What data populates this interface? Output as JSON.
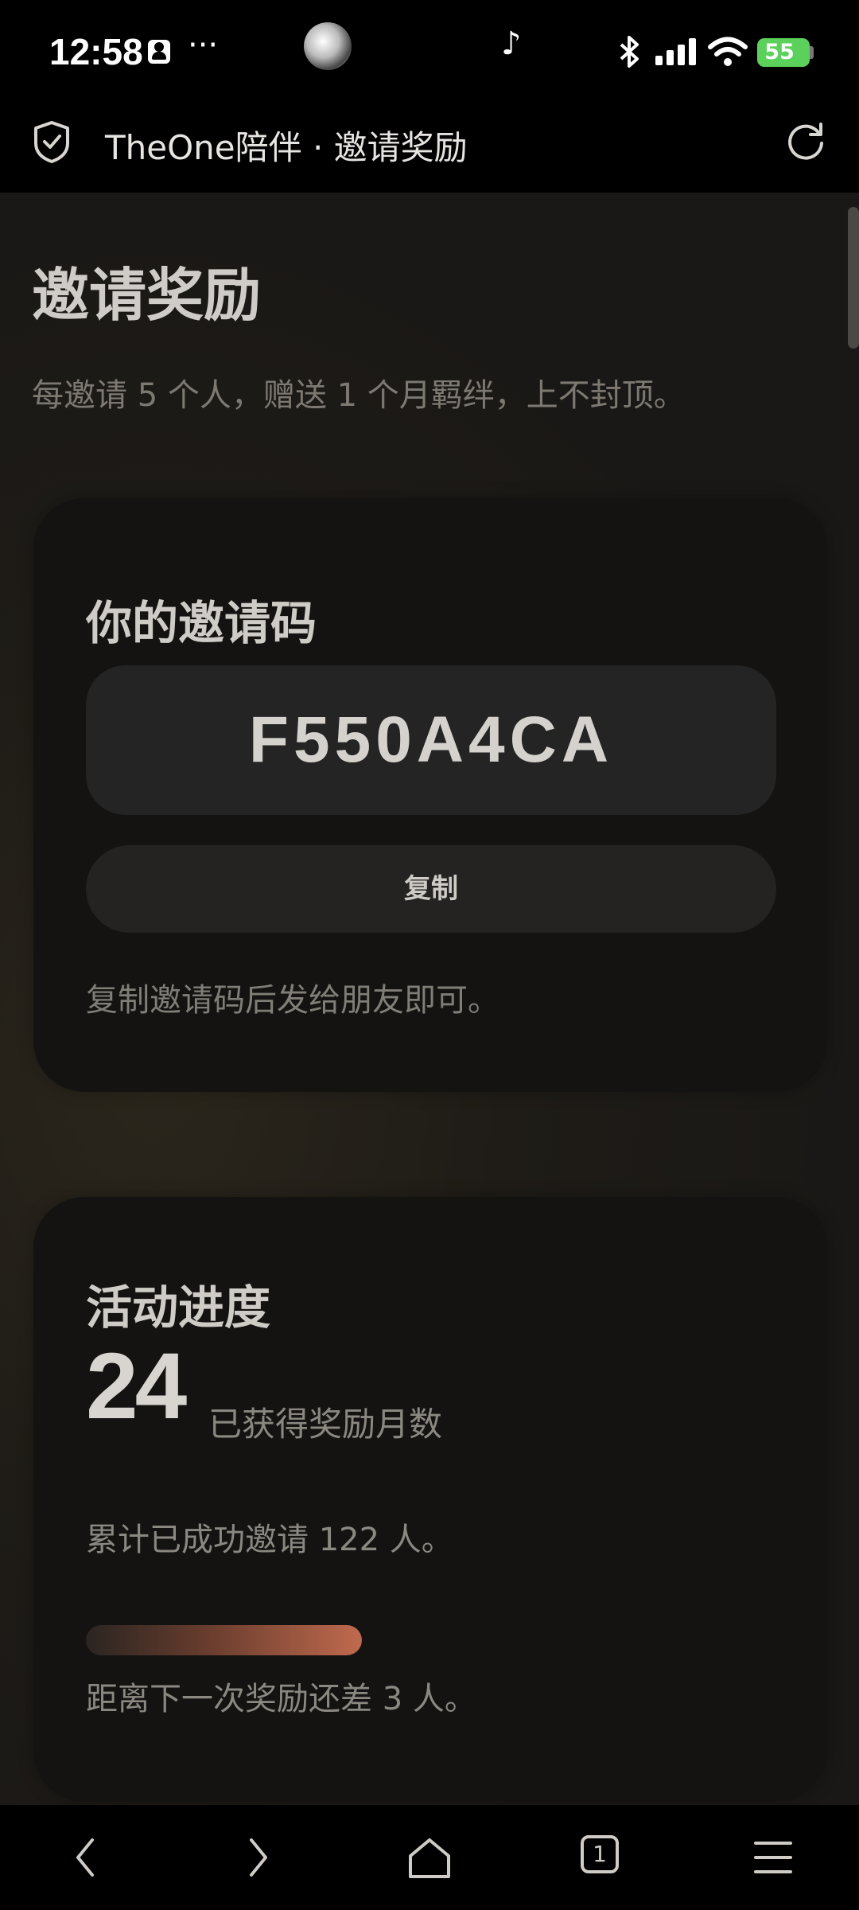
{
  "status_bar": {
    "time": "12:58",
    "dots": "···",
    "battery": "55"
  },
  "toolbar": {
    "title": "TheOne陪伴 · 邀请奖励"
  },
  "page": {
    "title": "邀请奖励",
    "subtitle": "每邀请 5 个人，赠送 1 个月羁绊，上不封顶。"
  },
  "invite_card": {
    "title": "你的邀请码",
    "code": "F550A4CA",
    "copy_label": "复制",
    "hint": "复制邀请码后发给朋友即可。"
  },
  "progress_card": {
    "title": "活动进度",
    "months": "24",
    "months_label": "已获得奖励月数",
    "total_text": "累计已成功邀请 122 人。",
    "progress_fraction": 0.4,
    "next_text": "距离下一次奖励还差 3 人。"
  },
  "nav": {
    "tab_count": "1"
  },
  "colors": {
    "accent": "#c06a4e",
    "battery": "#5bd15b"
  }
}
